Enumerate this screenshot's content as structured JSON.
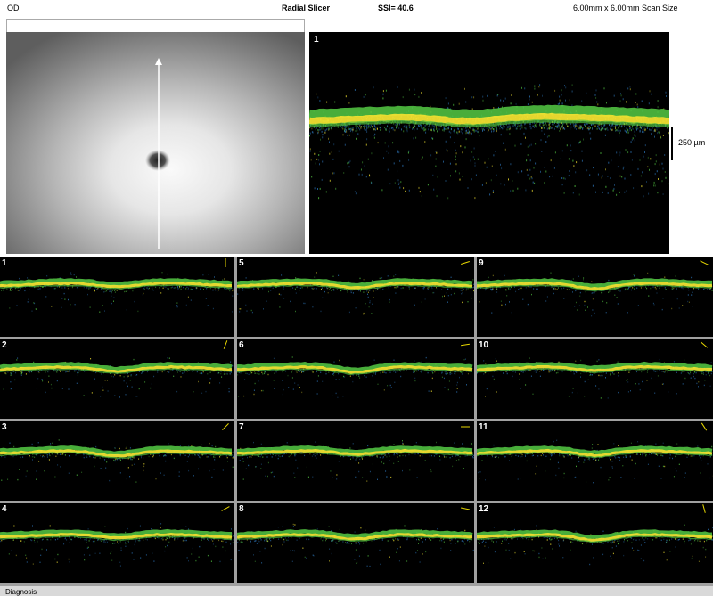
{
  "header": {
    "eye": "OD",
    "title": "Radial Slicer",
    "ssi": "SSI= 40.6",
    "scan_size": "6.00mm x 6.00mm Scan Size"
  },
  "main_scan": {
    "number": "1"
  },
  "scale_label": "250 µm",
  "thumbnails": [
    {
      "number": "1"
    },
    {
      "number": "2"
    },
    {
      "number": "3"
    },
    {
      "number": "4"
    },
    {
      "number": "5"
    },
    {
      "number": "6"
    },
    {
      "number": "7"
    },
    {
      "number": "8"
    },
    {
      "number": "9"
    },
    {
      "number": "10"
    },
    {
      "number": "11"
    },
    {
      "number": "12"
    }
  ],
  "footer": {
    "label": "Diagnosis"
  },
  "colors": {
    "scan_background": "#000000",
    "grid_background": "#a0a0a0",
    "retina_core": "#f0e030",
    "retina_mid": "#50c040",
    "retina_noise": "#2a6fb0",
    "scan_line": "#ffffff",
    "direction_arrow": "#e8d800"
  }
}
